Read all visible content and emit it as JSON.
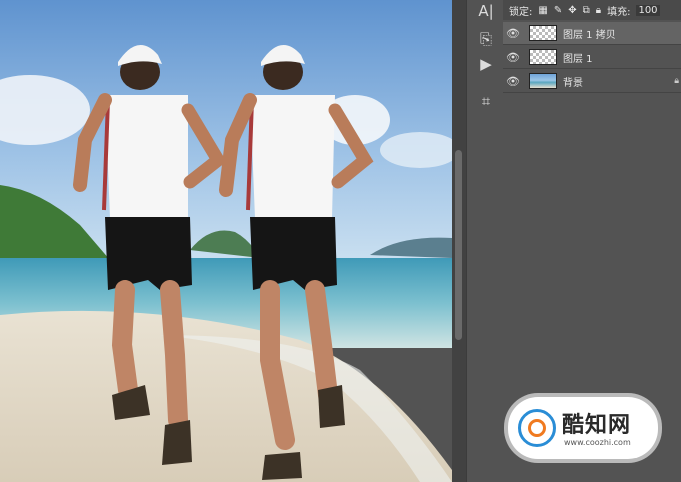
{
  "canvas": {
    "description_icon": "beach-runners-photo"
  },
  "toolbar": {
    "tools": [
      {
        "icon": "character-panel-icon",
        "glyph": "A|"
      },
      {
        "icon": "layer-comps-icon",
        "glyph": "⎘"
      },
      {
        "icon": "play-action-icon",
        "glyph": "▶"
      },
      {
        "icon": "crop-icon",
        "glyph": "⌗"
      }
    ]
  },
  "layers_panel": {
    "lock_label": "锁定:",
    "fill_label": "填充:",
    "fill_value": "100",
    "layers": [
      {
        "name": "图层 1 拷贝",
        "visible": true,
        "selected": true
      },
      {
        "name": "图层 1",
        "visible": true,
        "selected": false
      },
      {
        "name": "背景",
        "visible": true,
        "selected": false,
        "locked": true
      }
    ]
  },
  "watermark": {
    "title": "酷知网",
    "url": "www.coozhi.com"
  },
  "colors": {
    "panel_bg": "#535353",
    "selected_row": "#646464",
    "brand_blue": "#2a8dd6",
    "brand_orange": "#f07a20"
  }
}
